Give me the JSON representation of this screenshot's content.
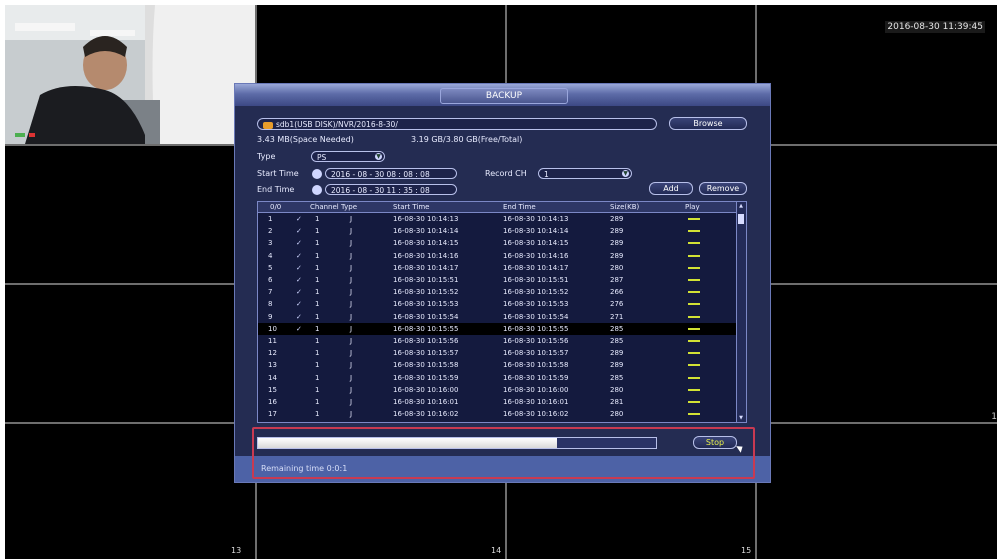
{
  "screen": {
    "datetime": "2016-08-30 11:39:45",
    "channel_numbers": [
      "13",
      "14",
      "15"
    ],
    "edge_mark": "1"
  },
  "dialog": {
    "title": "BACKUP",
    "device_path": "sdb1(USB DISK)/NVR/2016-8-30/",
    "browse_label": "Browse",
    "space_needed": "3.43 MB(Space Needed)",
    "free_total": "3.19 GB/3.80 GB(Free/Total)",
    "type_label": "Type",
    "type_value": "PS",
    "start_time_label": "Start Time",
    "start_time_value": "2016 - 08 - 30   08 : 08 : 08",
    "end_time_label": "End Time",
    "end_time_value": "2016 - 08 - 30   11 : 35 : 08",
    "record_ch_label": "Record CH",
    "record_ch_value": "1",
    "add_label": "Add",
    "remove_label": "Remove",
    "table": {
      "headers": [
        "0/0",
        "Channel Type",
        "Start Time",
        "End Time",
        "Size(KB)",
        "Play"
      ],
      "rows": [
        {
          "no": "1",
          "checked": true,
          "ch": "1",
          "type": "J",
          "start": "16-08-30 10:14:13",
          "end": "16-08-30 10:14:13",
          "size": "289",
          "selected": false
        },
        {
          "no": "2",
          "checked": true,
          "ch": "1",
          "type": "J",
          "start": "16-08-30 10:14:14",
          "end": "16-08-30 10:14:14",
          "size": "289",
          "selected": false
        },
        {
          "no": "3",
          "checked": true,
          "ch": "1",
          "type": "J",
          "start": "16-08-30 10:14:15",
          "end": "16-08-30 10:14:15",
          "size": "289",
          "selected": false
        },
        {
          "no": "4",
          "checked": true,
          "ch": "1",
          "type": "J",
          "start": "16-08-30 10:14:16",
          "end": "16-08-30 10:14:16",
          "size": "289",
          "selected": false
        },
        {
          "no": "5",
          "checked": true,
          "ch": "1",
          "type": "J",
          "start": "16-08-30 10:14:17",
          "end": "16-08-30 10:14:17",
          "size": "280",
          "selected": false
        },
        {
          "no": "6",
          "checked": true,
          "ch": "1",
          "type": "J",
          "start": "16-08-30 10:15:51",
          "end": "16-08-30 10:15:51",
          "size": "287",
          "selected": false
        },
        {
          "no": "7",
          "checked": true,
          "ch": "1",
          "type": "J",
          "start": "16-08-30 10:15:52",
          "end": "16-08-30 10:15:52",
          "size": "266",
          "selected": false
        },
        {
          "no": "8",
          "checked": true,
          "ch": "1",
          "type": "J",
          "start": "16-08-30 10:15:53",
          "end": "16-08-30 10:15:53",
          "size": "276",
          "selected": false
        },
        {
          "no": "9",
          "checked": true,
          "ch": "1",
          "type": "J",
          "start": "16-08-30 10:15:54",
          "end": "16-08-30 10:15:54",
          "size": "271",
          "selected": false
        },
        {
          "no": "10",
          "checked": true,
          "ch": "1",
          "type": "J",
          "start": "16-08-30 10:15:55",
          "end": "16-08-30 10:15:55",
          "size": "285",
          "selected": true
        },
        {
          "no": "11",
          "checked": false,
          "ch": "1",
          "type": "J",
          "start": "16-08-30 10:15:56",
          "end": "16-08-30 10:15:56",
          "size": "285",
          "selected": false
        },
        {
          "no": "12",
          "checked": false,
          "ch": "1",
          "type": "J",
          "start": "16-08-30 10:15:57",
          "end": "16-08-30 10:15:57",
          "size": "289",
          "selected": false
        },
        {
          "no": "13",
          "checked": false,
          "ch": "1",
          "type": "J",
          "start": "16-08-30 10:15:58",
          "end": "16-08-30 10:15:58",
          "size": "289",
          "selected": false
        },
        {
          "no": "14",
          "checked": false,
          "ch": "1",
          "type": "J",
          "start": "16-08-30 10:15:59",
          "end": "16-08-30 10:15:59",
          "size": "285",
          "selected": false
        },
        {
          "no": "15",
          "checked": false,
          "ch": "1",
          "type": "J",
          "start": "16-08-30 10:16:00",
          "end": "16-08-30 10:16:00",
          "size": "280",
          "selected": false
        },
        {
          "no": "16",
          "checked": false,
          "ch": "1",
          "type": "J",
          "start": "16-08-30 10:16:01",
          "end": "16-08-30 10:16:01",
          "size": "281",
          "selected": false
        },
        {
          "no": "17",
          "checked": false,
          "ch": "1",
          "type": "J",
          "start": "16-08-30 10:16:02",
          "end": "16-08-30 10:16:02",
          "size": "280",
          "selected": false
        }
      ]
    },
    "progress_fraction": 0.75,
    "stop_label": "Stop",
    "remaining_time": "Remaining time 0:0:1"
  },
  "colors": {
    "dialog_bg": "#242c52",
    "accent_play": "#d2e234",
    "highlight_border": "#c83a52"
  },
  "icons": [
    "usb-disk-icon",
    "clock-icon",
    "dropdown-icon",
    "checkbox-icon",
    "play-icon",
    "mouse-cursor-icon"
  ]
}
